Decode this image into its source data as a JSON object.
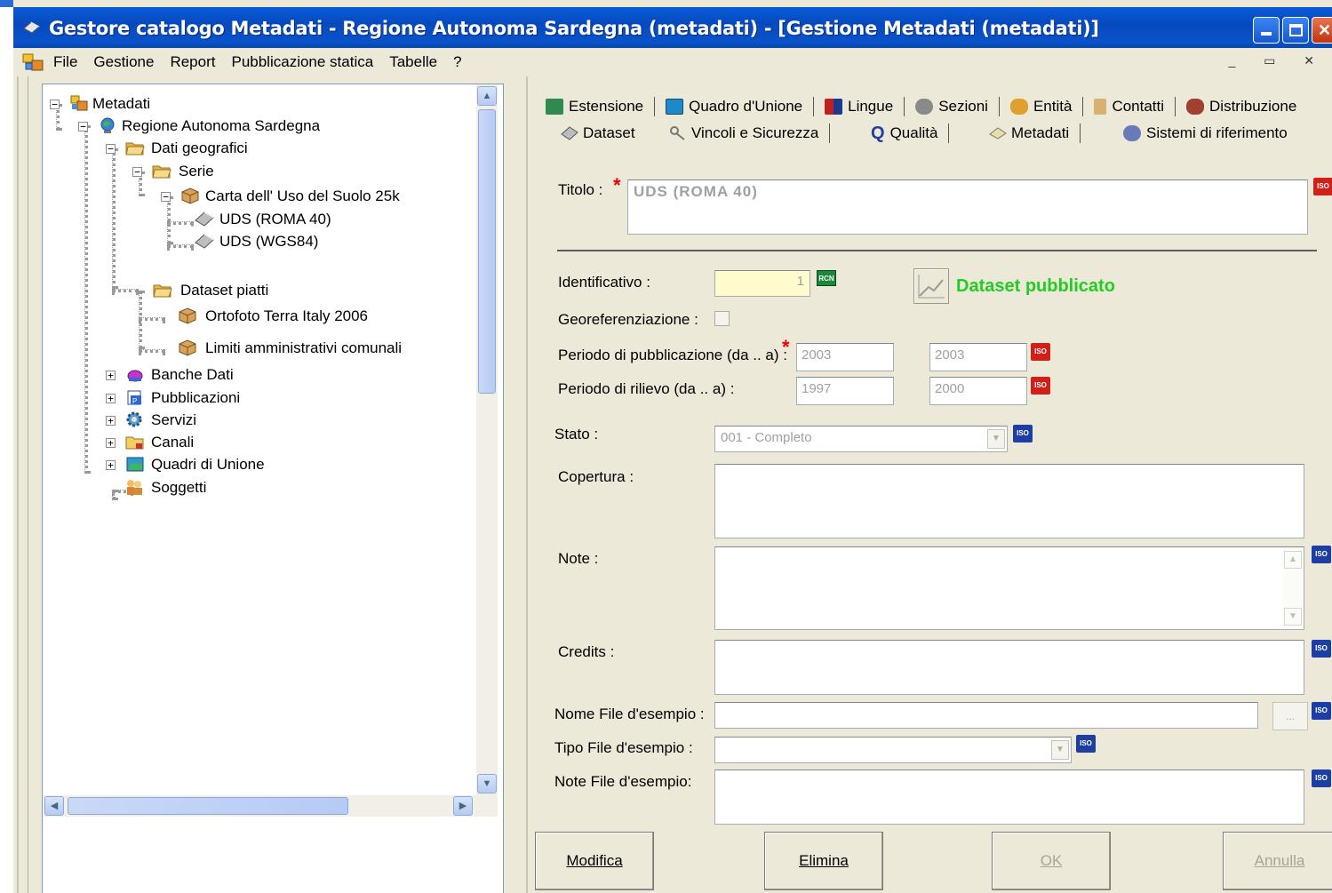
{
  "window": {
    "title": "Gestore catalogo Metadati - Regione Autonoma Sardegna (metadati) - [Gestione Metadati (metadati)]"
  },
  "menu": {
    "items": [
      "File",
      "Gestione",
      "Report",
      "Pubblicazione statica",
      "Tabelle",
      "?"
    ]
  },
  "tree": {
    "root": "Metadati",
    "region": "Regione Autonoma Sardegna",
    "geo": "Dati geografici",
    "serie": "Serie",
    "carta": "Carta dell' Uso del Suolo 25k",
    "uds_roma": "UDS (ROMA 40)",
    "uds_wgs": "UDS (WGS84)",
    "piatti": "Dataset piatti",
    "ortofoto": "Ortofoto Terra Italy 2006",
    "limiti": "Limiti amministrativi comunali",
    "banche": "Banche Dati",
    "pubblicazioni": "Pubblicazioni",
    "servizi": "Servizi",
    "canali": "Canali",
    "quadri": "Quadri di Unione",
    "soggetti": "Soggetti"
  },
  "tabs": {
    "row1": [
      "Estensione",
      "Quadro d'Unione",
      "Lingue",
      "Sezioni",
      "Entità",
      "Contatti",
      "Distribuzione"
    ],
    "row2": [
      "Dataset",
      "Vincoli e Sicurezza",
      "Qualità",
      "Metadati",
      "Sistemi di riferimento"
    ]
  },
  "form": {
    "titolo_label": "Titolo :",
    "titolo_value": "UDS (ROMA 40)",
    "identificativo_label": "Identificativo :",
    "identificativo_value": "1",
    "rcn_badge": "RCN",
    "published_text": "Dataset pubblicato",
    "georef_label": "Georeferenziazione :",
    "pub_label": "Periodo di pubblicazione (da .. a) :",
    "pub_from": "2003",
    "pub_to": "2003",
    "rilievo_label": "Periodo di rilievo (da .. a) :",
    "rilievo_from": "1997",
    "rilievo_to": "2000",
    "stato_label": "Stato :",
    "stato_value": "001 - Completo",
    "copertura_label": "Copertura :",
    "note_label": "Note :",
    "credits_label": "Credits :",
    "nome_file_label": "Nome File d'esempio :",
    "browse_label": "...",
    "tipo_file_label": "Tipo File d'esempio :",
    "note_file_label": "Note File d'esempio:",
    "iso_badge": "ISO"
  },
  "buttons": {
    "modifica": "Modifica",
    "elimina": "Elimina",
    "ok": "OK",
    "annulla": "Annulla"
  },
  "colors": {
    "title_bar": "#0a5cd8",
    "published_green": "#22cc22",
    "iso_red": "#d0201a",
    "iso_blue": "#1d3ea3"
  }
}
